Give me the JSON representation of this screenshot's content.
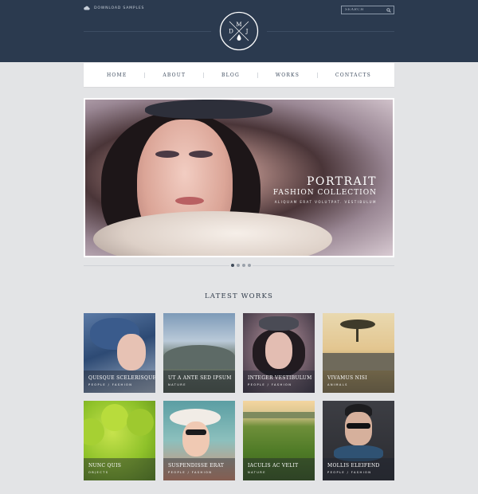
{
  "header": {
    "download_label": "DOWNLOAD SAMPLES",
    "search_placeholder": "SEARCH",
    "logo_letters": {
      "top": "M",
      "left": "D",
      "right": "J"
    }
  },
  "nav": {
    "items": [
      {
        "label": "HOME"
      },
      {
        "label": "ABOUT"
      },
      {
        "label": "BLOG"
      },
      {
        "label": "WORKS"
      },
      {
        "label": "CONTACTS"
      }
    ]
  },
  "hero": {
    "title": "PORTRAIT",
    "subtitle": "FASHION COLLECTION",
    "tagline": "ALIQUAM ERAT VOLUTPAT. VESTIBULUM"
  },
  "pager": {
    "count": 4,
    "active": 1
  },
  "latest": {
    "title": "LATEST WORKS",
    "works": [
      {
        "title": "QUISQUE SCELERISQUE",
        "category": "PEOPLE / FASHION"
      },
      {
        "title": "UT A ANTE SED IPSUM",
        "category": "NATURE"
      },
      {
        "title": "INTEGER VESTIBULUM",
        "category": "PEOPLE / FASHION"
      },
      {
        "title": "VIVAMUS NISI",
        "category": "ANIMALS"
      },
      {
        "title": "NUNC QUIS",
        "category": "OBJECTS"
      },
      {
        "title": "SUSPENDISSE ERAT",
        "category": "PEOPLE / FASHION"
      },
      {
        "title": "IACULIS AC VELIT",
        "category": "NATURE"
      },
      {
        "title": "MOLLIS ELEIFEND",
        "category": "PEOPLE / FASHION"
      }
    ]
  },
  "colors": {
    "header_bg": "#2b3a4f",
    "page_bg": "#e3e4e6",
    "nav_bg": "#ffffff",
    "text_dark": "#2f3a49"
  }
}
